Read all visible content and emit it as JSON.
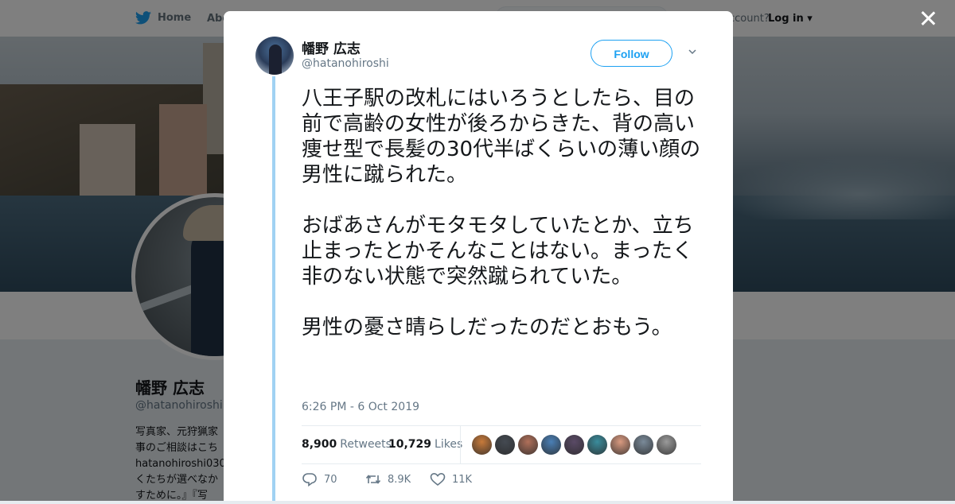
{
  "nav": {
    "home_label": "Home",
    "about_label": "Abo",
    "account_text": "ccount?",
    "login_label": "Log in"
  },
  "background_profile": {
    "name": "幡野 広志",
    "handle": "@hatanohiroshi",
    "bio": "写真家、元狩猟家\n事のご相談はこち\nhatanohiroshi030\nくたちが選べなか\nすために。』『写"
  },
  "tweet": {
    "author_name": "幡野 広志",
    "author_handle": "@hatanohiroshi",
    "follow_label": "Follow",
    "text": "八王子駅の改札にはいろうとしたら、目の前で高齢の女性が後ろからきた、背の高い痩せ型で長髪の30代半ばくらいの薄い顔の男性に蹴られた。\n\nおばあさんがモタモタしていたとか、立ち止まったとかそんなことはない。まったく非のない状態で突然蹴られていた。\n\n男性の憂さ晴らしだったのだとおもう。",
    "timestamp": "6:26 PM - 6 Oct 2019",
    "retweets_count": "8,900",
    "retweets_label": "Retweets",
    "likes_count": "10,729",
    "likes_label": "Likes",
    "replies_action": "70",
    "retweets_action": "8.9K",
    "likes_action": "11K"
  },
  "liker_avatars": [
    "#c77a3a",
    "#444a52",
    "#b0705a",
    "#4a7fb5",
    "#5a4a66",
    "#3a8c9c",
    "#d99a80",
    "#7a8a99",
    "#9a9a9a"
  ],
  "colors": {
    "accent": "#1da1f2",
    "thread_line": "#a0d2f3",
    "text_primary": "#14171a",
    "text_secondary": "#657786"
  }
}
